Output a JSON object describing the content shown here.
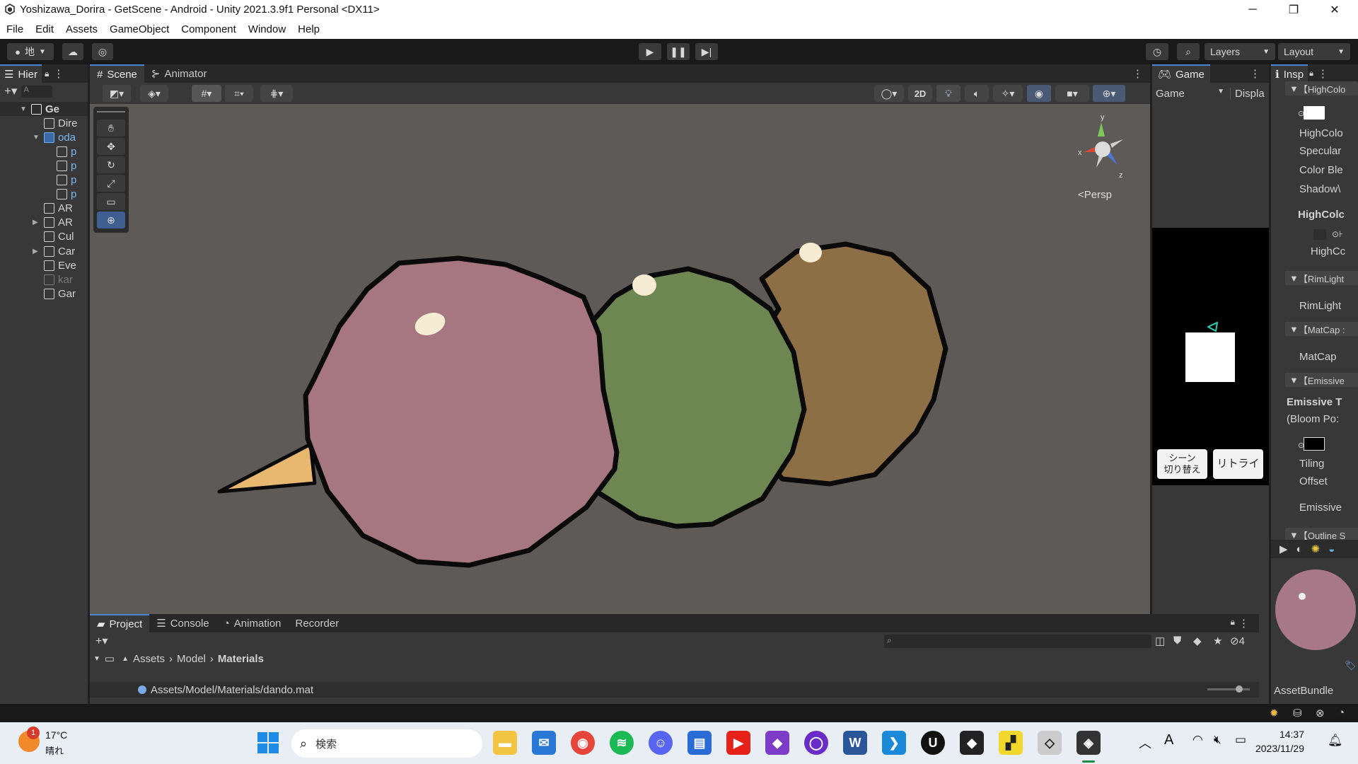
{
  "window": {
    "title": "Yoshizawa_Dorira - GetScene - Android - Unity 2021.3.9f1 Personal <DX11>",
    "minimize": "─",
    "restore": "❐",
    "close": "✕"
  },
  "menu": [
    "File",
    "Edit",
    "Assets",
    "GameObject",
    "Component",
    "Window",
    "Help"
  ],
  "toolbar": {
    "account_label": "地",
    "layers_label": "Layers",
    "layout_label": "Layout"
  },
  "hierarchy": {
    "tab_label": "Hier",
    "search_placeholder": "A",
    "rows": [
      {
        "label": "Ge",
        "indent": 0,
        "type": "scene",
        "arrow": "▼",
        "dim": false
      },
      {
        "label": "Dire",
        "indent": 1,
        "type": "obj",
        "arrow": "",
        "dim": false
      },
      {
        "label": "oda",
        "indent": 1,
        "type": "prefab",
        "arrow": "▼",
        "dim": false
      },
      {
        "label": "p",
        "indent": 2,
        "type": "obj",
        "arrow": "",
        "dim": false
      },
      {
        "label": "p",
        "indent": 2,
        "type": "obj",
        "arrow": "",
        "dim": false
      },
      {
        "label": "p",
        "indent": 2,
        "type": "obj",
        "arrow": "",
        "dim": false
      },
      {
        "label": "p",
        "indent": 2,
        "type": "obj",
        "arrow": "",
        "dim": false
      },
      {
        "label": "AR",
        "indent": 1,
        "type": "obj",
        "arrow": "",
        "dim": false
      },
      {
        "label": "AR",
        "indent": 1,
        "type": "obj",
        "arrow": "▶",
        "dim": false
      },
      {
        "label": "Cul",
        "indent": 1,
        "type": "obj",
        "arrow": "",
        "dim": false
      },
      {
        "label": "Car",
        "indent": 1,
        "type": "obj",
        "arrow": "▶",
        "dim": false
      },
      {
        "label": "Eve",
        "indent": 1,
        "type": "obj",
        "arrow": "",
        "dim": false
      },
      {
        "label": "kar",
        "indent": 1,
        "type": "obj",
        "arrow": "",
        "dim": true
      },
      {
        "label": "Gar",
        "indent": 1,
        "type": "obj",
        "arrow": "",
        "dim": false
      }
    ]
  },
  "scene": {
    "tabs": [
      "Scene",
      "Animator"
    ],
    "mode_2d": "2D",
    "persp_label": "<Persp",
    "gizmo_axes": {
      "y": "y",
      "x": "x",
      "z": "z"
    }
  },
  "game": {
    "tab_label": "Game",
    "display_dropdown": "Game",
    "display_label": "Displa",
    "button_scene": "シーン\n切り替え",
    "button_retry": "リトライ"
  },
  "inspector": {
    "tab_label": "Insp",
    "labels": {
      "highcolor_fold": "【HighColo",
      "highcolor": "HighColo",
      "specular": "Specular",
      "color_blend": "Color Ble",
      "shadow": "Shadow\\",
      "highcolor_bold": "HighColc",
      "highcolor_sub": "HighCc",
      "rimlight_fold": "【RimLight",
      "rimlight": "RimLight",
      "matcap_fold": "【MatCap :",
      "matcap": "MatCap",
      "emissive_fold": "【Emissive",
      "emissive_bold": "Emissive T",
      "bloom": "(Bloom Po:",
      "tiling": "Tiling",
      "offset": "Offset",
      "emissive": "Emissive",
      "outline_fold": "【Outline S",
      "assetbundle": "AssetBundle"
    },
    "preview_color": "#a67888"
  },
  "project": {
    "tabs": [
      "Project",
      "Console",
      "Animation",
      "Recorder"
    ],
    "breadcrumb": [
      "Assets",
      "Model",
      "Materials"
    ],
    "hidden_count": "4",
    "selected_path": "Assets/Model/Materials/dando.mat"
  },
  "taskbar": {
    "weather_temp": "17°C",
    "weather_desc": "晴れ",
    "weather_badge": "1",
    "search_placeholder": "検索",
    "ime": "A",
    "time": "14:37",
    "date": "2023/11/29"
  },
  "colors": {
    "pink": "#a67681",
    "green": "#6e8752",
    "brown": "#8d6f45",
    "stick": "#e8b871",
    "scene_bg": "#5e5a58"
  }
}
